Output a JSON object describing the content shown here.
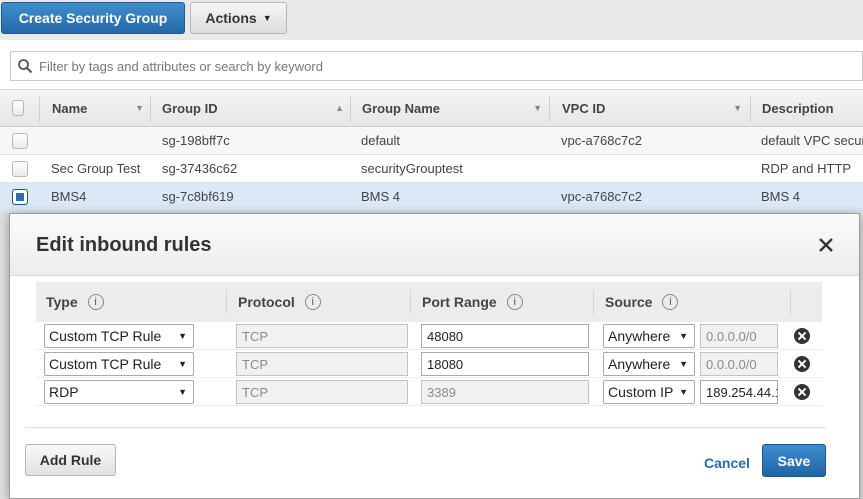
{
  "toolbar": {
    "create_label": "Create Security Group",
    "actions_label": "Actions"
  },
  "search": {
    "placeholder": "Filter by tags and attributes or search by keyword"
  },
  "table": {
    "columns": [
      "Name",
      "Group ID",
      "Group Name",
      "VPC ID",
      "Description"
    ],
    "rows": [
      {
        "name": "",
        "group_id": "sg-198bff7c",
        "group_name": "default",
        "vpc_id": "vpc-a768c7c2",
        "description": "default VPC security group",
        "selected": false
      },
      {
        "name": "Sec Group Test",
        "group_id": "sg-37436c62",
        "group_name": "securityGrouptest",
        "vpc_id": "",
        "description": "RDP and HTTP",
        "selected": false
      },
      {
        "name": "BMS4",
        "group_id": "sg-7c8bf619",
        "group_name": "BMS 4",
        "vpc_id": "vpc-a768c7c2",
        "description": "BMS 4",
        "selected": true
      }
    ]
  },
  "modal": {
    "title": "Edit inbound rules",
    "columns": {
      "type": "Type",
      "protocol": "Protocol",
      "port_range": "Port Range",
      "source": "Source"
    },
    "info_glyph": "i",
    "rules": [
      {
        "type": "Custom TCP Rule",
        "protocol": "TCP",
        "port": "48080",
        "port_editable": true,
        "source": "Anywhere",
        "cidr": "0.0.0.0/0",
        "cidr_editable": false
      },
      {
        "type": "Custom TCP Rule",
        "protocol": "TCP",
        "port": "18080",
        "port_editable": true,
        "source": "Anywhere",
        "cidr": "0.0.0.0/0",
        "cidr_editable": false
      },
      {
        "type": "RDP",
        "protocol": "TCP",
        "port": "3389",
        "port_editable": false,
        "source": "Custom IP",
        "cidr": "189.254.44.1",
        "cidr_editable": true
      }
    ],
    "add_rule_label": "Add Rule",
    "cancel_label": "Cancel",
    "save_label": "Save"
  },
  "icons": {
    "search": "search-icon",
    "close": "close-icon",
    "remove": "remove-rule-icon",
    "info": "info-icon",
    "caret": "caret-down-icon"
  },
  "colors": {
    "primary": "#2468a8",
    "link": "#1f6eb6",
    "selected_row": "#dbe8f5"
  }
}
